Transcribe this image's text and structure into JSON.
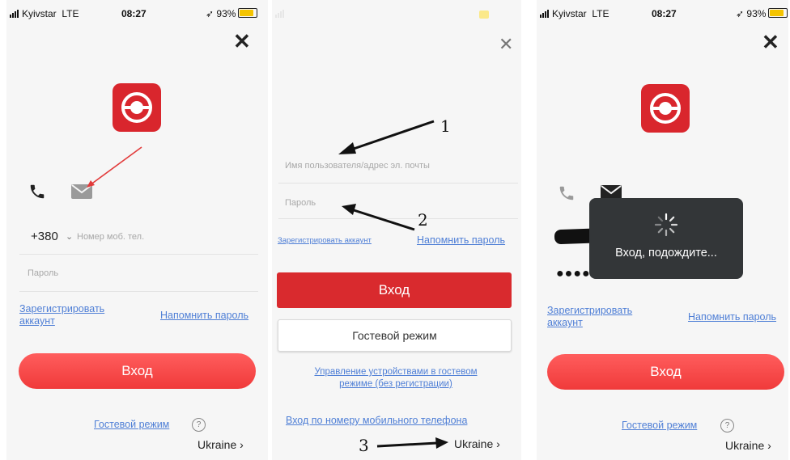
{
  "status_bar": {
    "carrier": "Kyivstar",
    "network": "LTE",
    "time": "08:27",
    "battery": "93%",
    "battery_color": "#f5c400"
  },
  "icons": {
    "close": "close-icon",
    "phone": "phone-icon",
    "mail": "mail-icon",
    "logo": "camera-logo-icon",
    "spinner": "loading-spinner-icon",
    "help": "question-icon",
    "chevron": "chevron-right-icon"
  },
  "colors": {
    "brand_red": "#d9262d",
    "link_blue": "#4f7fd6",
    "annotation_red": "#e23b3b"
  },
  "panel1": {
    "country_code": "+380",
    "phone_placeholder": "Номер моб. тел.",
    "password_placeholder": "Пароль",
    "register_line1": "Зарегистрировать",
    "register_line2": "аккаунт",
    "forgot": "Напомнить пароль",
    "login": "Вход",
    "guest": "Гостевой режим",
    "help": "?",
    "country": "Ukraine",
    "chevron": "›"
  },
  "panel2": {
    "username_placeholder": "Имя пользователя/адрес эл. почты",
    "password_placeholder": "Пароль",
    "register": "Зарегистрировать аккаунт",
    "forgot": "Напомнить пароль",
    "login": "Вход",
    "guest": "Гостевой режим",
    "guest_manage_line1": "Управление устройствами в гостевом",
    "guest_manage_line2": "режиме (без регистрации)",
    "phone_login": "Вход по номеру мобильного телефона",
    "country": "Ukraine",
    "chevron": "›",
    "annotations": [
      "1",
      "2",
      "3"
    ]
  },
  "panel3": {
    "password_dots": "●●●●●●●●●●",
    "toast": "Вход, подождите...",
    "register_line1": "Зарегистрировать",
    "register_line2": "аккаунт",
    "forgot": "Напомнить пароль",
    "login": "Вход",
    "guest": "Гостевой режим",
    "help": "?",
    "country": "Ukraine",
    "chevron": "›"
  }
}
